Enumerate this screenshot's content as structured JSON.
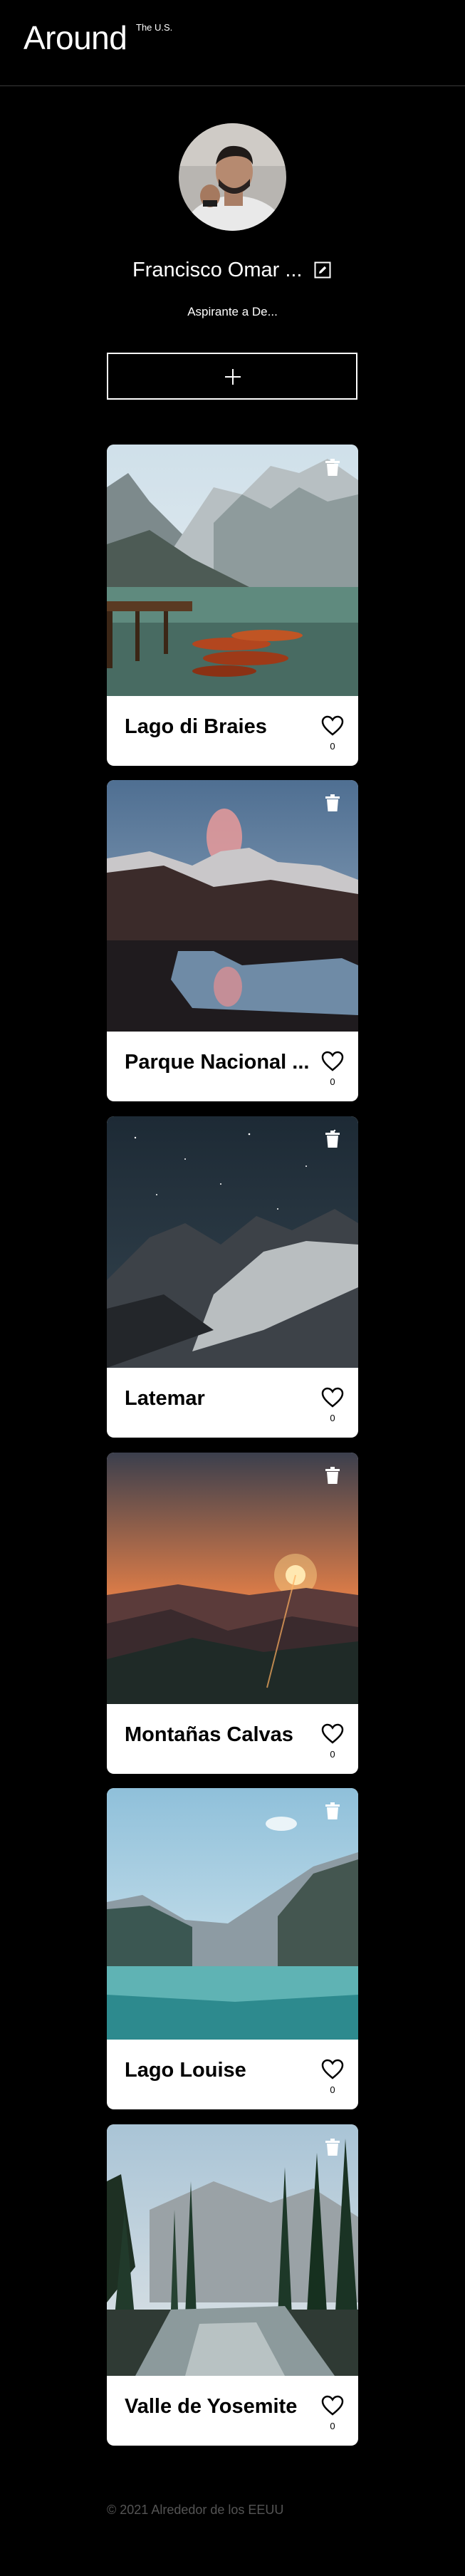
{
  "header": {
    "logo": "Around",
    "logo_sup": "The U.S."
  },
  "profile": {
    "name": "Francisco Omar ...",
    "about": "Aspirante a De..."
  },
  "cards": [
    {
      "title": "Lago di Braies",
      "likes": "0"
    },
    {
      "title": "Parque Nacional ...",
      "likes": "0"
    },
    {
      "title": "Latemar",
      "likes": "0"
    },
    {
      "title": "Montañas Calvas",
      "likes": "0"
    },
    {
      "title": "Lago Louise",
      "likes": "0"
    },
    {
      "title": "Valle de Yosemite",
      "likes": "0"
    }
  ],
  "icons": {
    "add": "plus-icon",
    "edit": "pencil-square-icon",
    "delete": "trash-icon",
    "like": "heart-outline-icon"
  },
  "footer": {
    "copyright": "© 2021 Alrededor de los EEUU"
  },
  "colors": {
    "background": "#000000",
    "card": "#ffffff",
    "footer_text": "#545454"
  }
}
